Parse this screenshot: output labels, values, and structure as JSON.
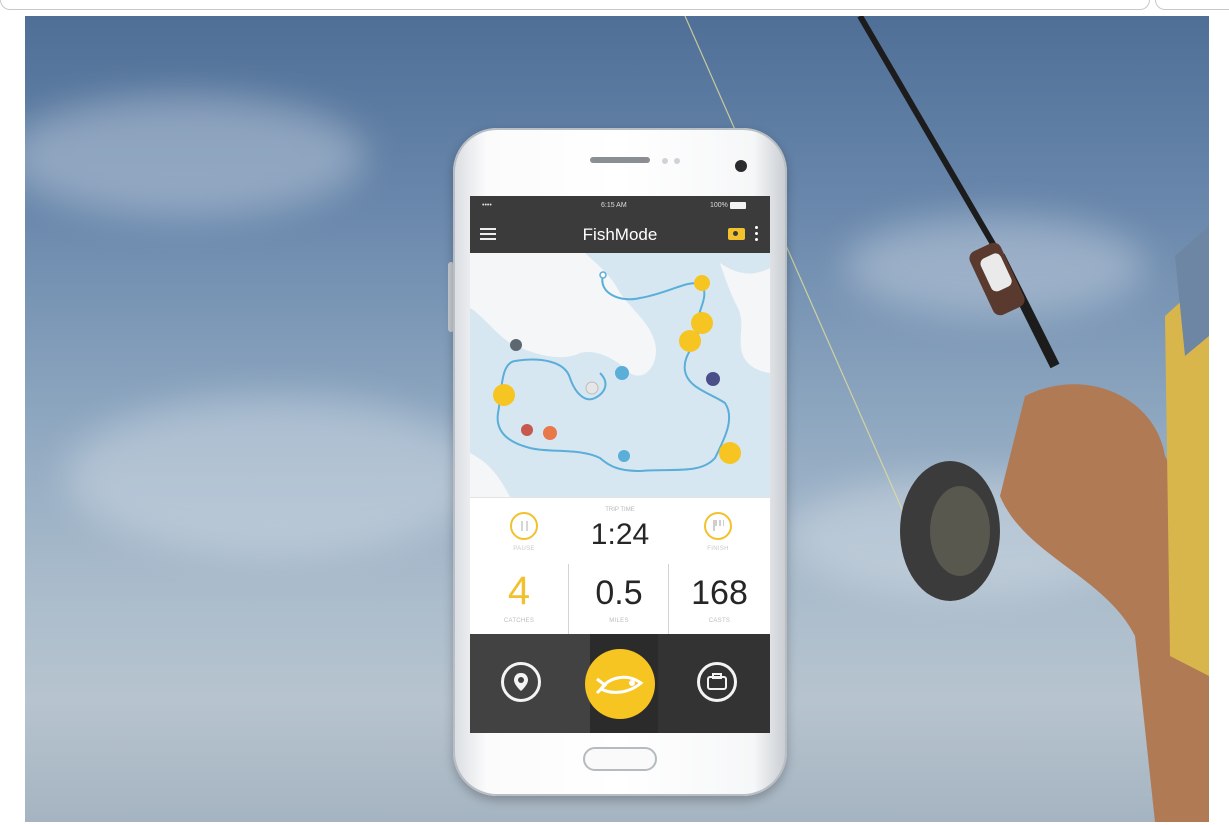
{
  "status": {
    "signal": "•••• ",
    "time": "6:15 AM",
    "battery": "100%"
  },
  "app": {
    "title": "FishMode"
  },
  "trip": {
    "time_label": "TRIP TIME",
    "time_value": "1:24",
    "pause_label": "PAUSE",
    "finish_label": "FINISH"
  },
  "stats": [
    {
      "value": "4",
      "label": "CATCHES"
    },
    {
      "value": "0.5",
      "label": "MILES"
    },
    {
      "value": "168",
      "label": "CASTS"
    }
  ],
  "colors": {
    "accent": "#f2c12e",
    "bar": "#3b3b3b",
    "map_water": "#d6e7f2",
    "route": "#5aaed8"
  },
  "icons": {
    "menu": "menu-icon",
    "camera": "camera-icon",
    "more": "more-vert-icon",
    "location": "location-pin-icon",
    "fish": "fish-logo-icon",
    "tackle": "tackle-box-icon"
  }
}
